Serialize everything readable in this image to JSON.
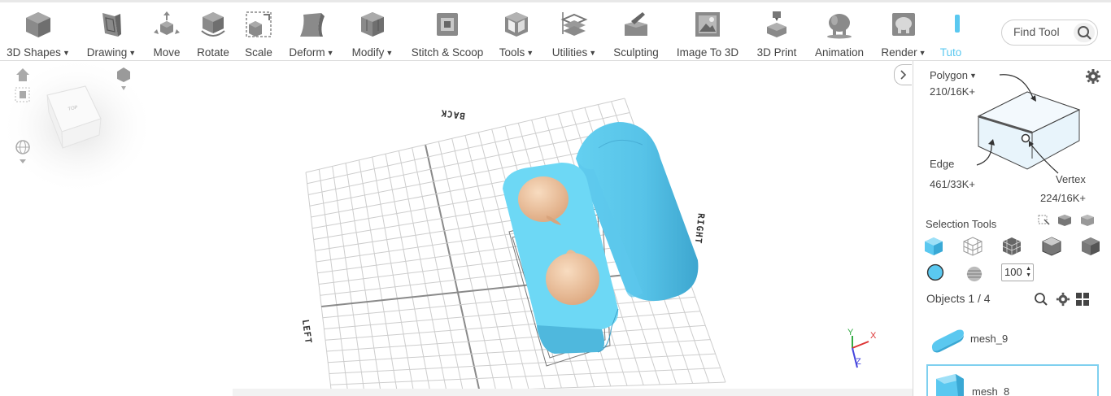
{
  "toolbar": {
    "items": [
      {
        "label": "3D Shapes",
        "dropdown": true,
        "icon": "cube-icon"
      },
      {
        "label": "Drawing",
        "dropdown": true,
        "icon": "drawing-icon"
      },
      {
        "label": "Move",
        "dropdown": false,
        "icon": "move-icon"
      },
      {
        "label": "Rotate",
        "dropdown": false,
        "icon": "rotate-icon"
      },
      {
        "label": "Scale",
        "dropdown": false,
        "icon": "scale-icon"
      },
      {
        "label": "Deform",
        "dropdown": true,
        "icon": "deform-icon"
      },
      {
        "label": "Modify",
        "dropdown": true,
        "icon": "modify-icon"
      },
      {
        "label": "Stitch & Scoop",
        "dropdown": false,
        "icon": "stitch-scoop-icon"
      },
      {
        "label": "Tools",
        "dropdown": true,
        "icon": "tools-icon"
      },
      {
        "label": "Utilities",
        "dropdown": true,
        "icon": "utilities-icon"
      },
      {
        "label": "Sculpting",
        "dropdown": false,
        "icon": "sculpting-icon"
      },
      {
        "label": "Image To 3D",
        "dropdown": false,
        "icon": "image-to-3d-icon"
      },
      {
        "label": "3D Print",
        "dropdown": false,
        "icon": "3d-print-icon"
      },
      {
        "label": "Animation",
        "dropdown": false,
        "icon": "animation-icon"
      },
      {
        "label": "Render",
        "dropdown": true,
        "icon": "render-icon"
      },
      {
        "label": "Tuto",
        "dropdown": false,
        "icon": "tutorial-icon",
        "accent": "#5ac8f0"
      }
    ],
    "find_tool": {
      "placeholder": "Find Tool"
    }
  },
  "viewport": {
    "axis_labels": {
      "back": "BACK",
      "right": "RIGHT",
      "left": "LEFT"
    },
    "view_cube": {
      "face_label": "TOP"
    },
    "gizmo": {
      "y": "Y",
      "x": "X",
      "z": "Z"
    },
    "colors": {
      "mesh": "#6dd8f5",
      "mesh_dark": "#4fb7dc",
      "insert": "#f1c8a3",
      "grid": "#c9c9c9"
    }
  },
  "panel": {
    "polygon": {
      "label": "Polygon",
      "count": "210/16K+"
    },
    "edge": {
      "label": "Edge",
      "count": "461/33K+"
    },
    "vertex": {
      "label": "Vertex",
      "count": "224/16K+"
    },
    "selection_tools_label": "Selection Tools",
    "brush_size": "100",
    "objects_label": "Objects 1 / 4",
    "objects": [
      {
        "name": "mesh_9",
        "selected": false
      },
      {
        "name": "mesh_8",
        "selected": true
      }
    ]
  }
}
